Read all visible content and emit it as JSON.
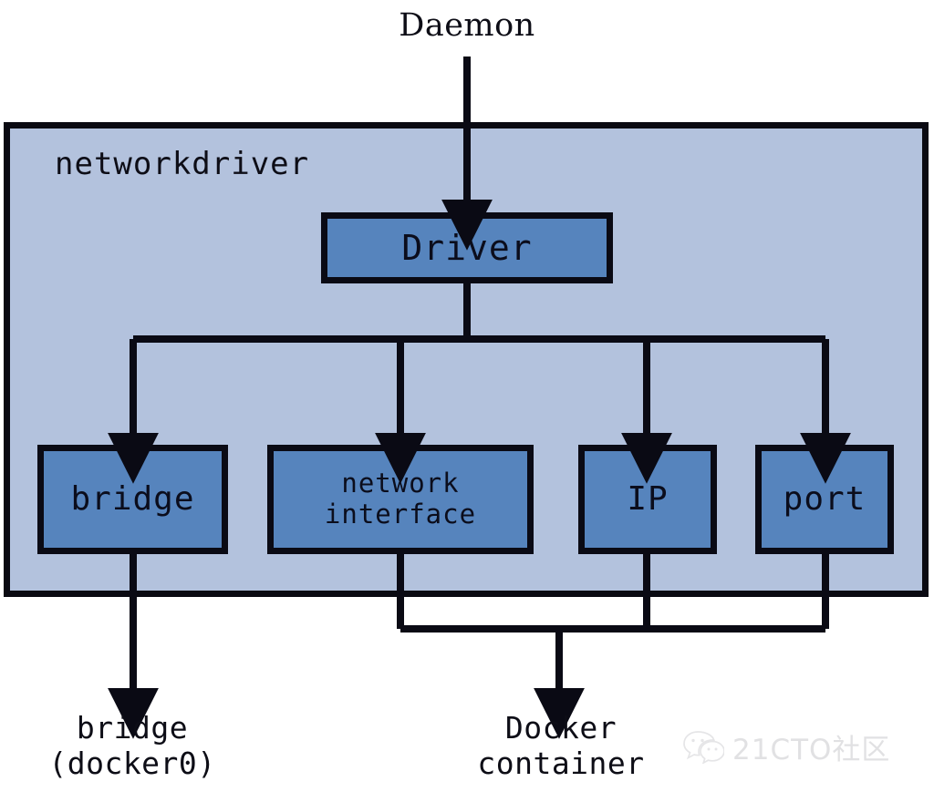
{
  "diagram": {
    "title": "networkdriver",
    "top_label": "Daemon",
    "container_label": "networkdriver",
    "nodes": {
      "driver": "Driver",
      "bridge": "bridge",
      "network_interface_line1": "network",
      "network_interface_line2": "interface",
      "ip": "IP",
      "port": "port"
    },
    "outputs": {
      "bridge_line1": "bridge",
      "bridge_line2": "(docker0)",
      "docker_line1": "Docker",
      "docker_line2": "container"
    },
    "colors": {
      "container_fill": "#b3c2dd",
      "node_fill": "#5684bd",
      "stroke": "#0a0a14",
      "background": "#ffffff",
      "text": "#0b0d1c",
      "watermark": "#b9b9bd"
    }
  },
  "watermark": {
    "icon": "wechat-logo-icon",
    "text": "21CTO社区"
  }
}
